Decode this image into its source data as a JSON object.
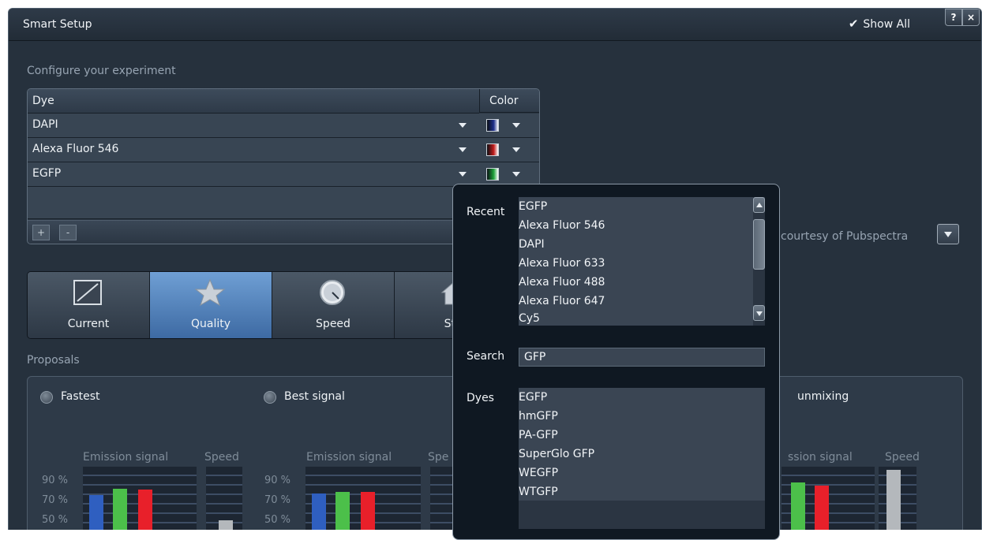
{
  "window": {
    "title": "Smart Setup",
    "show_all_label": "Show All",
    "help_label": "?",
    "close_label": "×"
  },
  "config": {
    "label": "Configure your experiment",
    "columns": {
      "dye": "Dye",
      "color": "Color"
    },
    "rows": [
      {
        "dye": "DAPI",
        "color": "#1e2f8c"
      },
      {
        "dye": "Alexa Fluor 546",
        "color": "#c21a1a"
      },
      {
        "dye": "EGFP",
        "color": "#1ea53a"
      }
    ],
    "add_label": "+",
    "remove_label": "-"
  },
  "spectra_note": "courtesy of Pubspectra",
  "modes": [
    {
      "label": "Current",
      "selected": false
    },
    {
      "label": "Quality",
      "selected": true
    },
    {
      "label": "Speed",
      "selected": false
    },
    {
      "label": "Star",
      "selected": false
    }
  ],
  "proposals": {
    "label": "Proposals",
    "options": [
      {
        "label": "Fastest"
      },
      {
        "label": "Best signal"
      },
      {
        "label": "unmixing"
      }
    ],
    "chart_headers": {
      "emission": "Emission signal",
      "speed": "Speed",
      "emission_partial": "ssion signal",
      "speed_partial": "Spe"
    },
    "percent_labels": [
      "90 %",
      "70 %",
      "50 %"
    ],
    "bar_colors": {
      "blue": "#2f5fc0",
      "green": "#4cc04a",
      "red": "#e8202a",
      "gray": "#b4b8bc"
    }
  },
  "popup": {
    "recent_label": "Recent",
    "recent_items": [
      "EGFP",
      "Alexa Fluor 546",
      "DAPI",
      "Alexa Fluor 633",
      "Alexa Fluor 488",
      "Alexa Fluor 647",
      "Cy5"
    ],
    "search_label": "Search",
    "search_value": "GFP",
    "dyes_label": "Dyes",
    "dye_results": [
      "EGFP",
      "hmGFP",
      "PA-GFP",
      "SuperGlo GFP",
      "WEGFP",
      "WTGFP"
    ]
  }
}
